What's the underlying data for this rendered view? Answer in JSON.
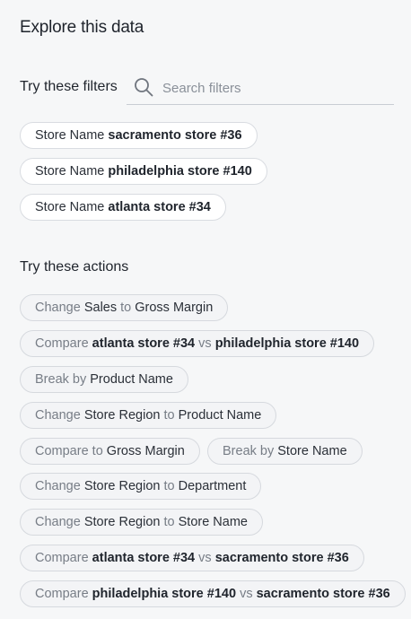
{
  "panel": {
    "title": "Explore this data"
  },
  "filters": {
    "label": "Try these filters",
    "search_placeholder": "Search filters",
    "items": [
      {
        "field": "Store Name",
        "value": "sacramento store #36"
      },
      {
        "field": "Store Name",
        "value": "philadelphia store #140"
      },
      {
        "field": "Store Name",
        "value": "atlanta store #34"
      }
    ]
  },
  "actions": {
    "label": "Try these actions",
    "items": [
      {
        "verb": "Change",
        "a": "Sales",
        "joiner": "to",
        "b": "Gross Margin"
      },
      {
        "verb": "Compare",
        "a": "atlanta store #34",
        "joiner": "vs",
        "b": "philadelphia store #140"
      },
      {
        "verb": "Break by",
        "a": "Product Name"
      },
      {
        "verb": "Change",
        "a": "Store Region",
        "joiner": "to",
        "b": "Product Name"
      },
      {
        "verb": "Compare to",
        "a": "Gross Margin"
      },
      {
        "verb": "Break by",
        "a": "Store Name"
      },
      {
        "verb": "Change",
        "a": "Store Region",
        "joiner": "to",
        "b": "Department"
      },
      {
        "verb": "Change",
        "a": "Store Region",
        "joiner": "to",
        "b": "Store Name"
      },
      {
        "verb": "Compare",
        "a": "atlanta store #34",
        "joiner": "vs",
        "b": "sacramento store #36"
      },
      {
        "verb": "Compare",
        "a": "philadelphia store #140",
        "joiner": "vs",
        "b": "sacramento store #36"
      }
    ]
  }
}
